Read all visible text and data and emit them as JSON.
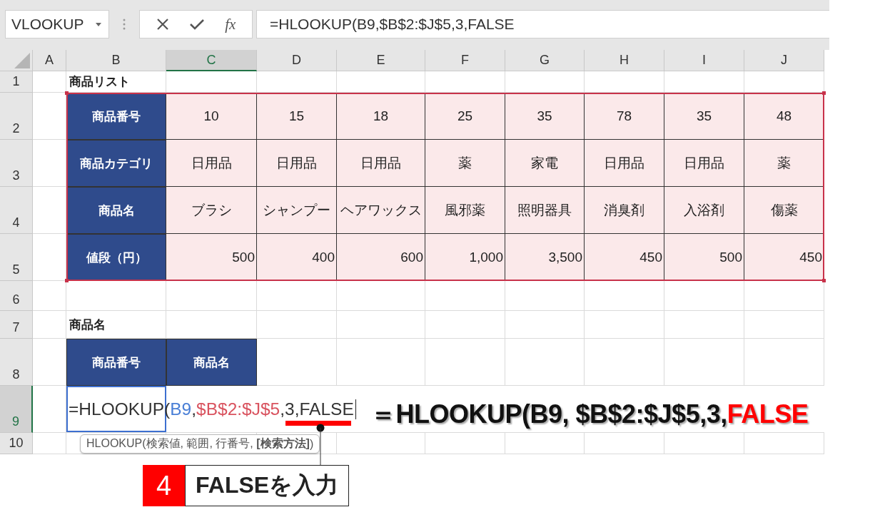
{
  "name_box": {
    "value": "VLOOKUP"
  },
  "formula_bar": {
    "fx_label": "fx",
    "value": "=HLOOKUP(B9,$B$2:$J$5,3,FALSE"
  },
  "columns": [
    {
      "label": "A",
      "selected": false
    },
    {
      "label": "B",
      "selected": false
    },
    {
      "label": "C",
      "selected": true
    },
    {
      "label": "D",
      "selected": false
    },
    {
      "label": "E",
      "selected": false
    },
    {
      "label": "F",
      "selected": false
    },
    {
      "label": "G",
      "selected": false
    },
    {
      "label": "H",
      "selected": false
    },
    {
      "label": "I",
      "selected": false
    },
    {
      "label": "J",
      "selected": false
    }
  ],
  "rows": [
    {
      "label": "1",
      "selected": false
    },
    {
      "label": "2",
      "selected": false
    },
    {
      "label": "3",
      "selected": false
    },
    {
      "label": "4",
      "selected": false
    },
    {
      "label": "5",
      "selected": false
    },
    {
      "label": "6",
      "selected": false
    },
    {
      "label": "7",
      "selected": false
    },
    {
      "label": "8",
      "selected": false
    },
    {
      "label": "9",
      "selected": true
    },
    {
      "label": "10",
      "selected": false
    }
  ],
  "list_title": "商品リスト",
  "product_table": [
    {
      "kind": "text",
      "header": "商品番号",
      "values": [
        "10",
        "15",
        "18",
        "25",
        "35",
        "78",
        "35",
        "48"
      ]
    },
    {
      "kind": "text",
      "header": "商品カテゴリ",
      "values": [
        "日用品",
        "日用品",
        "日用品",
        "薬",
        "家電",
        "日用品",
        "日用品",
        "薬"
      ]
    },
    {
      "kind": "text",
      "header": "商品名",
      "values": [
        "ブラシ",
        "シャンプー",
        "ヘアワックス",
        "風邪薬",
        "照明器具",
        "消臭剤",
        "入浴剤",
        "傷薬"
      ]
    },
    {
      "kind": "amount",
      "header": "値段（円）",
      "values": [
        "500",
        "400",
        "600",
        "1,000",
        "3,500",
        "450",
        "500",
        "450"
      ]
    }
  ],
  "lookup_title": "商品名",
  "lookup_headers": [
    "商品番号",
    "商品名"
  ],
  "active_cell": [
    {
      "text": "=HLOOKUP(",
      "color": "#333333"
    },
    {
      "text": "B9",
      "color": "#4a7fd6"
    },
    {
      "text": ",",
      "color": "#333333"
    },
    {
      "text": "$B$2:$J$5",
      "color": "#d9535f"
    },
    {
      "text": ",3,FALSE",
      "color": "#333333"
    }
  ],
  "tooltip": "HLOOKUP(検索値, 範囲, 行番号, **[検索方法]**)",
  "annotation": [
    {
      "text": "＝HLOOKUP(B9, $B$2:$J$5,3,",
      "color": "#111111"
    },
    {
      "text": "FALSE",
      "color": "#ff0000"
    }
  ],
  "callout": {
    "step": "4",
    "text": "FALSEを入力"
  }
}
